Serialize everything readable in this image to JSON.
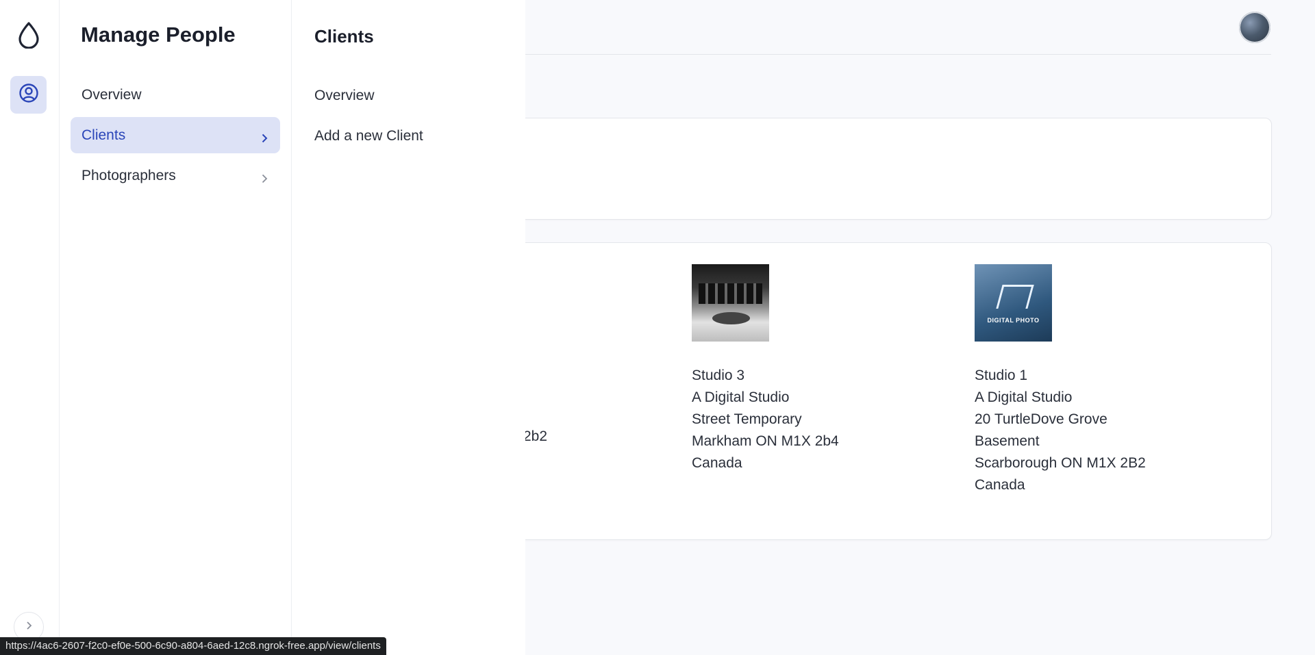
{
  "sidebar_rail": {
    "brand_icon": "droplet-icon",
    "active_icon": "user-circle-icon",
    "expand_icon": "chevron-right-icon"
  },
  "menu": {
    "title": "Manage People",
    "items": [
      {
        "label": "Overview",
        "active": false,
        "has_submenu": false
      },
      {
        "label": "Clients",
        "active": true,
        "has_submenu": true
      },
      {
        "label": "Photographers",
        "active": false,
        "has_submenu": true
      }
    ]
  },
  "submenu": {
    "title": "Clients",
    "items": [
      {
        "label": "Overview"
      },
      {
        "label": "Add a new Client"
      }
    ]
  },
  "page": {
    "partial_text": "2b2",
    "clients": [
      {
        "thumbnail": "studio-photo",
        "lines": [
          "Studio 3",
          "A Digital Studio",
          "Street Temporary",
          "Markham ON M1X 2b4",
          "Canada"
        ]
      },
      {
        "thumbnail": "digital-photo-logo",
        "logo_text": "DIGITAL PHOTO",
        "lines": [
          "Studio 1",
          "A Digital Studio",
          "20 TurtleDove Grove",
          "Basement",
          "Scarborough ON M1X 2B2",
          "Canada"
        ]
      }
    ]
  },
  "status_bar": {
    "url": "https://4ac6-2607-f2c0-ef0e-500-6c90-a804-6aed-12c8.ngrok-free.app/view/clients"
  },
  "colors": {
    "accent": "#2a45b8",
    "active_bg": "#dde2f6",
    "page_bg": "#f8f9fc"
  }
}
